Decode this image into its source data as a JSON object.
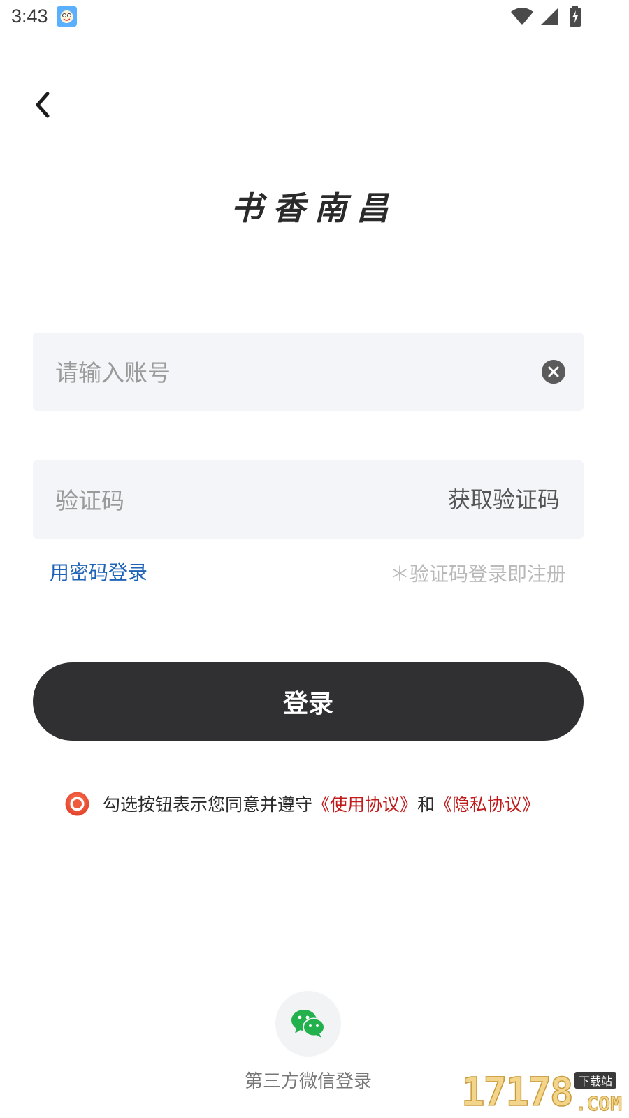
{
  "status_bar": {
    "time": "3:43",
    "app_icon": "smiley-app-icon",
    "wifi_icon": "wifi-icon",
    "signal_icon": "signal-icon",
    "battery_icon": "battery-charging-icon"
  },
  "header": {
    "back_icon": "chevron-left-icon"
  },
  "logo": {
    "text": "书香南昌"
  },
  "account_field": {
    "value": "",
    "placeholder": "请输入账号",
    "clear_icon": "close-circle-icon"
  },
  "code_field": {
    "value": "",
    "placeholder": "验证码",
    "get_code_label": "获取验证码"
  },
  "options": {
    "password_login_label": "用密码登录",
    "register_hint": "＊验证码登录即注册"
  },
  "login_button": {
    "label": "登录"
  },
  "agreement": {
    "checked": false,
    "prefix": "勾选按钮表示您同意并遵守",
    "terms_link": "《使用协议》",
    "conjunction": "和",
    "privacy_link": "《隐私协议》"
  },
  "third_party": {
    "wechat_icon": "wechat-icon",
    "wechat_label": "第三方微信登录"
  },
  "watermark": {
    "digits": "17178",
    "tag": "下载站",
    "domain": ".COM"
  },
  "colors": {
    "accent_link": "#1e63b8",
    "agreement_link": "#c01a1a",
    "login_button": "#303032",
    "field_bg": "#f4f5f8",
    "radio": "#ef5a3c",
    "wechat": "#22b14c"
  }
}
